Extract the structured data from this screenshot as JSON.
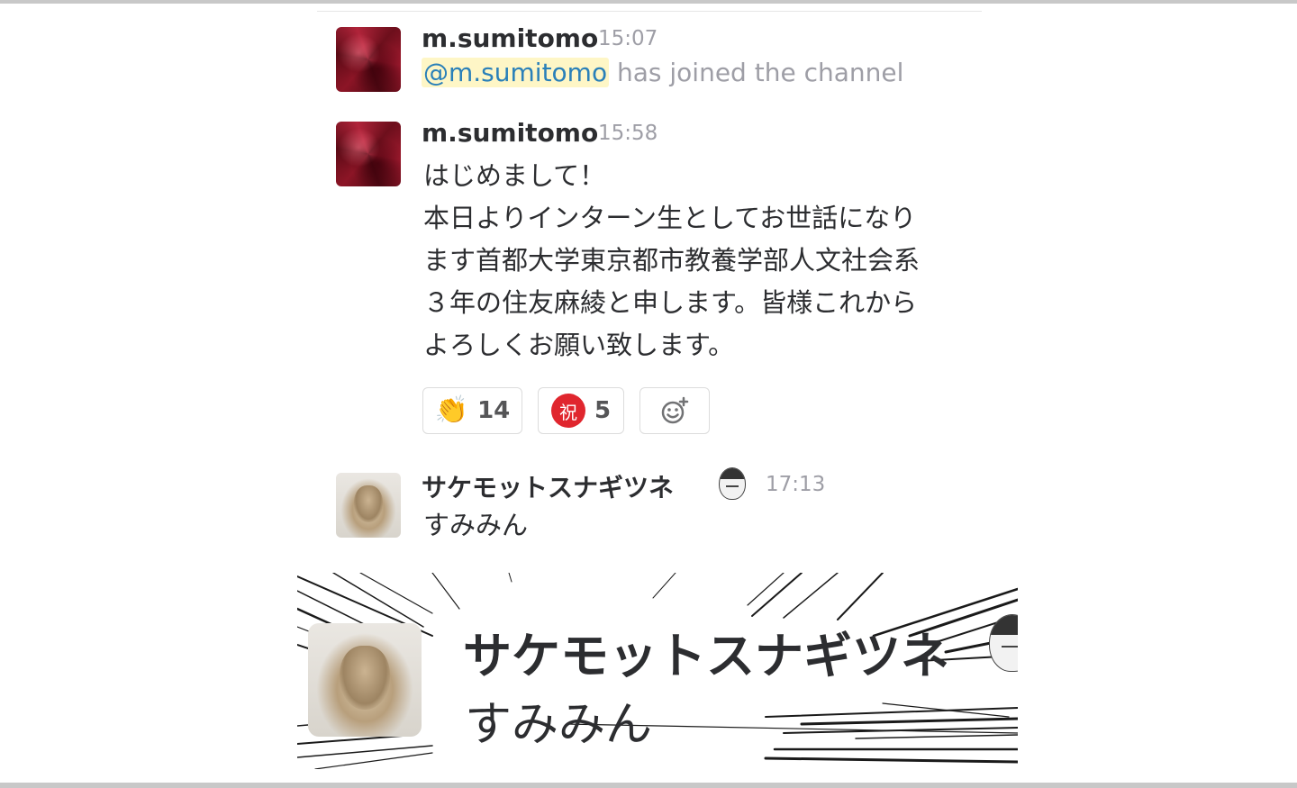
{
  "messages": [
    {
      "sender": "m.sumitomo",
      "time": "15:07",
      "mention": "@m.sumitomo",
      "join_text": " has joined the channel"
    },
    {
      "sender": "m.sumitomo",
      "time": "15:58",
      "body": "はじめまして！\n本日よりインターン生としてお世話になり\nます首都大学東京都市教養学部人文社会系\n３年の住友麻綾と申します。皆様これから\nよろしくお願い致します。",
      "reactions": [
        {
          "emoji": "clap-hands",
          "glyph": "👏",
          "count": "14"
        },
        {
          "emoji": "congratulations",
          "glyph": "祝",
          "count": "5"
        },
        {
          "emoji": "add-reaction",
          "glyph": "☺"
        }
      ]
    },
    {
      "sender": "サケモットスナギツネ",
      "time": "17:13",
      "body": "すみみん"
    }
  ],
  "zoom": {
    "sender": "サケモットスナギツネ",
    "body": "すみみん"
  },
  "colors": {
    "mention_bg": "#fef6c6",
    "mention_text": "#2a80b9",
    "timestamp": "#9e9ea6",
    "celebrate_red": "#e0262e"
  }
}
